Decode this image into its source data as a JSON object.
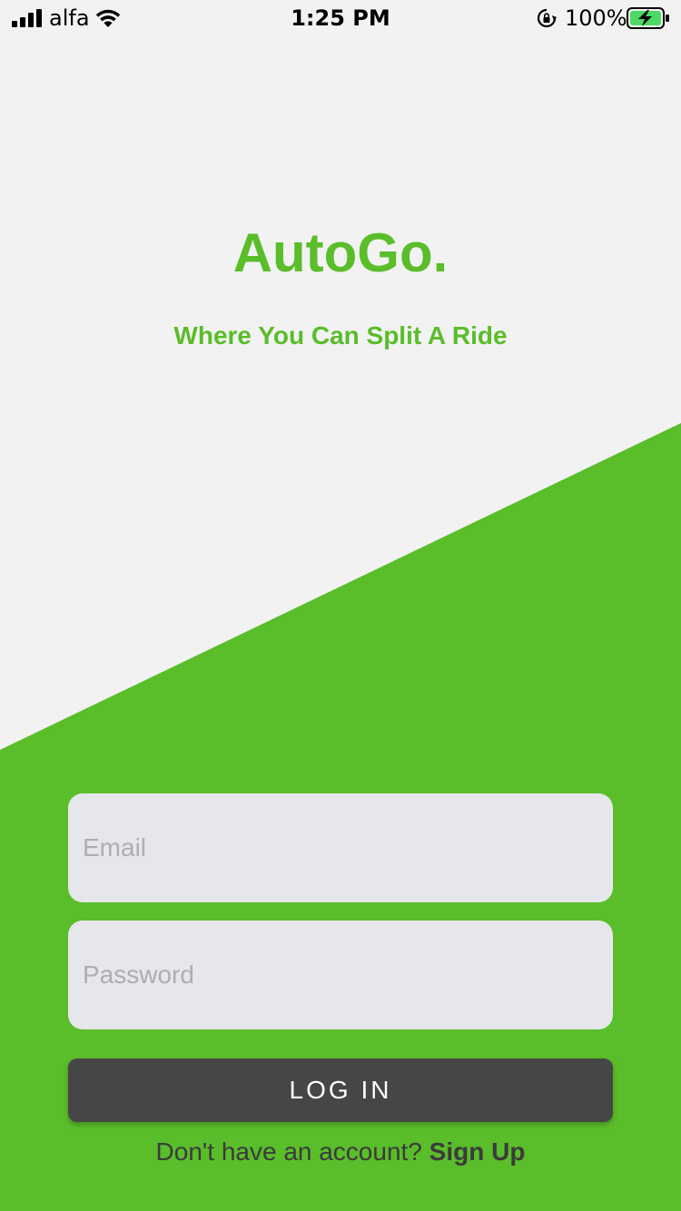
{
  "status_bar": {
    "carrier": "alfa",
    "time": "1:25 PM",
    "battery_percent": "100%",
    "icons": [
      "signal-icon",
      "wifi-icon",
      "rotation-lock-icon",
      "battery-charging-icon"
    ]
  },
  "brand": {
    "title": "AutoGo.",
    "subtitle": "Where You Can Split A Ride"
  },
  "form": {
    "email_placeholder": "Email",
    "email_value": "",
    "password_placeholder": "Password",
    "password_value": "",
    "login_label": "LOG IN"
  },
  "signup": {
    "prompt": "Don't have an account?",
    "link_label": "Sign Up"
  },
  "colors": {
    "background": "#f2f2f2",
    "accent_green": "#5abd2a",
    "field_background": "#e6e7ea",
    "button_background": "#464646",
    "battery_fill": "#4cd964"
  }
}
